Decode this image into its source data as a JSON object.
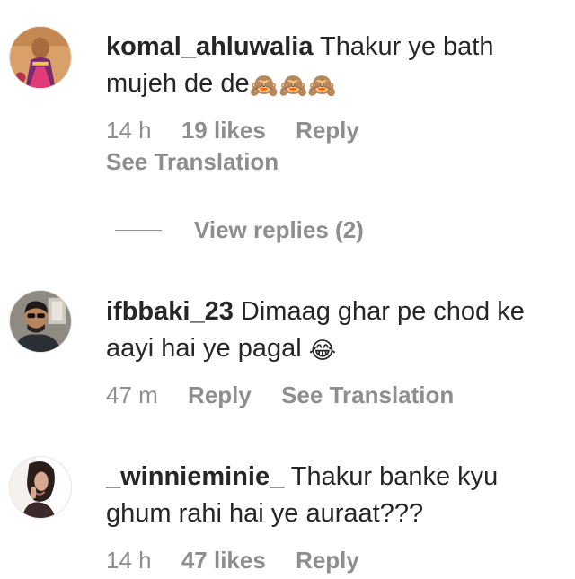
{
  "comments": [
    {
      "username": "komal_ahluwalia",
      "text": "Thakur ye bath mujeh de de",
      "emoji": "🙈🙈🙈",
      "time": "14 h",
      "likes": "19 likes",
      "reply": "Reply",
      "see_translation": "See Translation"
    },
    {
      "username": "ifbbaki_23",
      "text": "Dimaag ghar pe chod ke aayi hai ye pagal",
      "emoji": "😂",
      "time": "47 m",
      "reply": "Reply",
      "see_translation": "See Translation"
    },
    {
      "username": "_winnieminie_",
      "text": "Thakur banke kyu ghum rahi hai ye auraat???",
      "time": "14 h",
      "likes": "47 likes",
      "reply": "Reply"
    }
  ],
  "view_replies": "View replies (2)"
}
